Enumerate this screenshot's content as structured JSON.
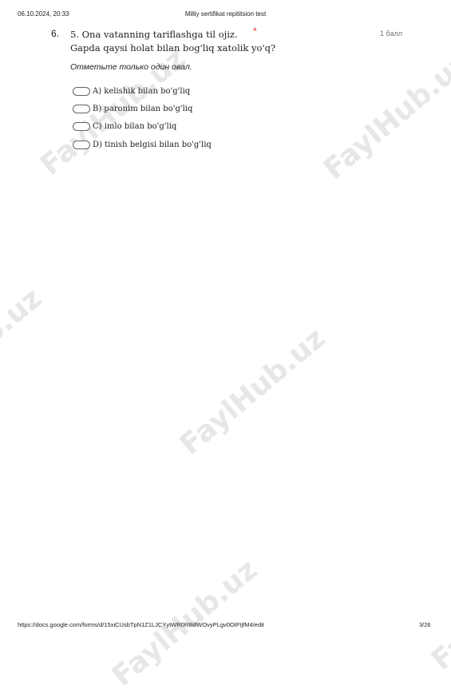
{
  "header": {
    "date": "06.10.2024, 20:33",
    "title": "Milliy sertifikat repititsion test"
  },
  "question": {
    "number": "6.",
    "text_line1": "5. Ona vatanning tariflashga til  ojiz.",
    "text_line2": "Gapda qaysi holat bilan bog'liq xatolik yo'q?",
    "required_mark": "*",
    "points": "1 балл",
    "hint": "Отметьте только один овал.",
    "options": [
      {
        "label": "A) kelishik bilan bo'g'liq"
      },
      {
        "label": "B) paronim bilan bo'g'liq"
      },
      {
        "label": "C) imlo bilan bo'g'liq"
      },
      {
        "label": "D) tinish belgisi bilan bo'g'liq"
      }
    ]
  },
  "footer": {
    "url": "https://docs.google.com/forms/d/15xiCUsbTpN1Z1LJCYytWR0R8i8WOvyPLgv0OtFtjfM4/edit",
    "page": "3/26"
  },
  "watermark": {
    "text": "FaylHub.uz"
  }
}
